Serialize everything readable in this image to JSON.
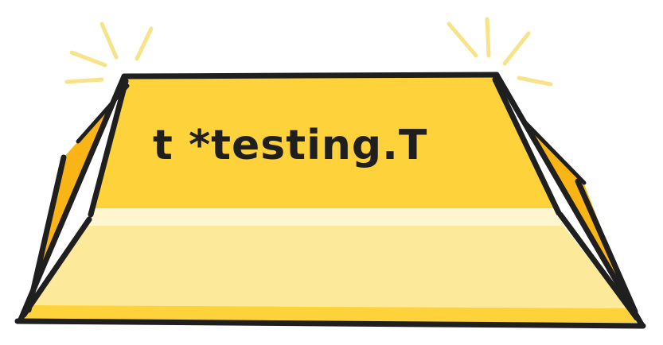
{
  "illustration": {
    "label": "t *testing.T",
    "colors": {
      "top_face": "#fdd23a",
      "front_face": "#fde99a",
      "side_face": "#f9b516",
      "highlight": "#fff5cf",
      "outline": "#1f1f1f",
      "shine": "#f7e48a"
    },
    "icons": [
      "gold-bar-icon",
      "shine-lines-icon"
    ]
  }
}
